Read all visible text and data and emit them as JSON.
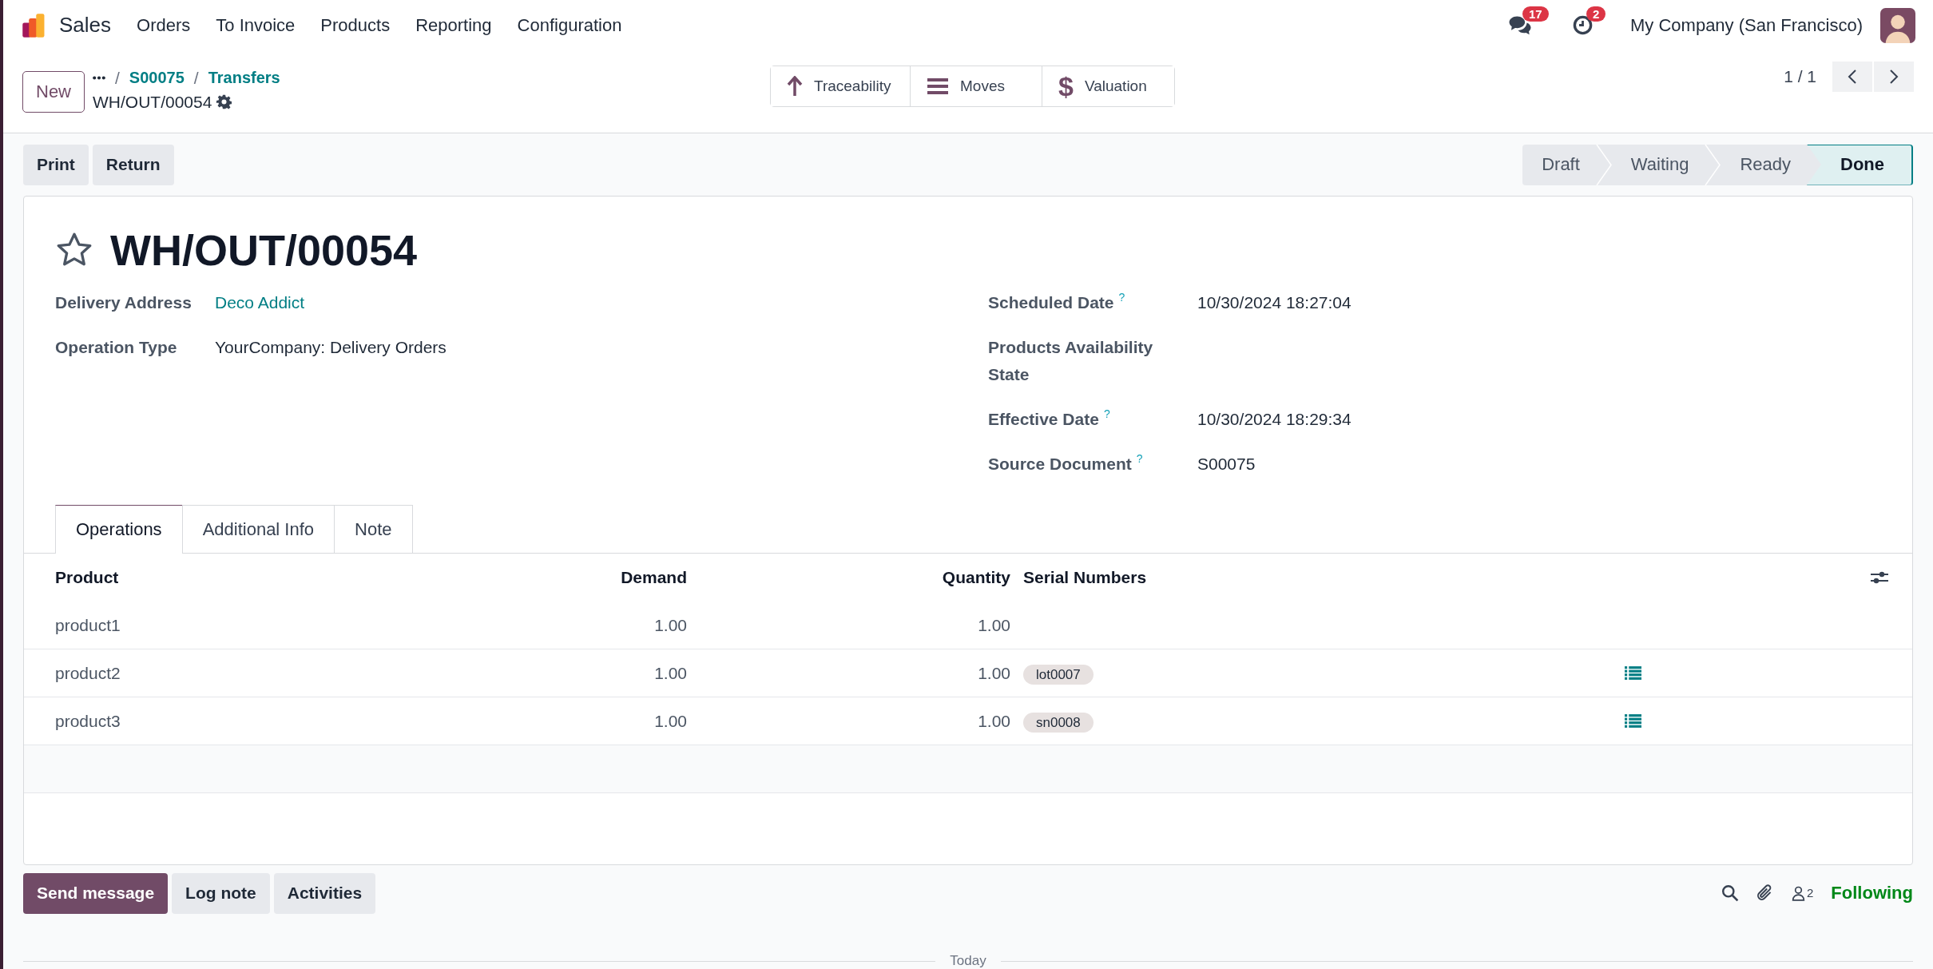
{
  "navbar": {
    "app": "Sales",
    "menu": [
      "Orders",
      "To Invoice",
      "Products",
      "Reporting",
      "Configuration"
    ],
    "messages_count": "17",
    "activities_count": "2",
    "company": "My Company (San Francisco)"
  },
  "control_panel": {
    "new_button": "New",
    "separator": "/",
    "breadcrumbs": [
      "S00075",
      "Transfers"
    ],
    "record": "WH/OUT/00054",
    "smart_buttons": [
      {
        "kind": "arrow",
        "label": "Traceability"
      },
      {
        "kind": "list",
        "label": "Moves"
      },
      {
        "kind": "glyph",
        "glyph": "$",
        "label": "Valuation"
      }
    ],
    "pager": "1 / 1"
  },
  "actions": [
    "Print",
    "Return"
  ],
  "statusbar": [
    {
      "label": "Draft",
      "selected": false
    },
    {
      "label": "Waiting",
      "selected": false
    },
    {
      "label": "Ready",
      "selected": false
    },
    {
      "label": "Done",
      "selected": true
    }
  ],
  "form": {
    "title": "WH/OUT/00054",
    "starred": false,
    "fields_left": [
      {
        "label": "Delivery Address",
        "value": "Deco Addict",
        "kind": "link"
      },
      {
        "label": "Operation Type",
        "value": "YourCompany: Delivery Orders",
        "kind": "text"
      }
    ],
    "fields_right": [
      {
        "label": "Scheduled Date",
        "help": "?",
        "value": "10/30/2024 18:27:04"
      },
      {
        "label": "Products Availability State"
      },
      {
        "label": "Effective Date",
        "help": "?",
        "value": "10/30/2024 18:29:34"
      },
      {
        "label": "Source Document",
        "help": "?",
        "value": "S00075"
      }
    ]
  },
  "tabs": [
    {
      "label": "Operations",
      "selected": true
    },
    {
      "label": "Additional Info",
      "selected": false
    },
    {
      "label": "Note",
      "selected": false
    }
  ],
  "table": {
    "columns": [
      "Product",
      "Demand",
      "Quantity",
      "Serial Numbers"
    ],
    "rows": [
      {
        "product": "product1",
        "demand": "1.00",
        "quantity": "1.00",
        "detail_button": false
      },
      {
        "product": "product2",
        "demand": "1.00",
        "quantity": "1.00",
        "serial": "lot0007",
        "detail_button": true
      },
      {
        "product": "product3",
        "demand": "1.00",
        "quantity": "1.00",
        "serial": "sn0008",
        "detail_button": true
      }
    ]
  },
  "chatter": {
    "buttons": [
      {
        "label": "Send message",
        "kind": "primary"
      },
      {
        "label": "Log note",
        "kind": "secondary"
      },
      {
        "label": "Activities",
        "kind": "secondary"
      }
    ],
    "followers_count": "2",
    "following": "Following",
    "divider": "Today"
  }
}
